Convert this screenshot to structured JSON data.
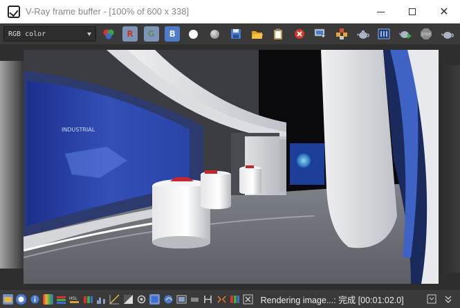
{
  "window": {
    "title": "V-Ray frame buffer - [100% of 600 x 338]"
  },
  "toolbar": {
    "channel": "RGB color",
    "r_label": "R",
    "g_label": "G",
    "b_label": "B"
  },
  "status": {
    "text": "Rendering image...: 完成 [00:01:02.0]"
  },
  "colors": {
    "toolbar_bg": "#3a3a3a",
    "titlebar_bg": "#ffffff",
    "accent_blue": "#4f7cc9",
    "clear_red": "#d9342b"
  }
}
